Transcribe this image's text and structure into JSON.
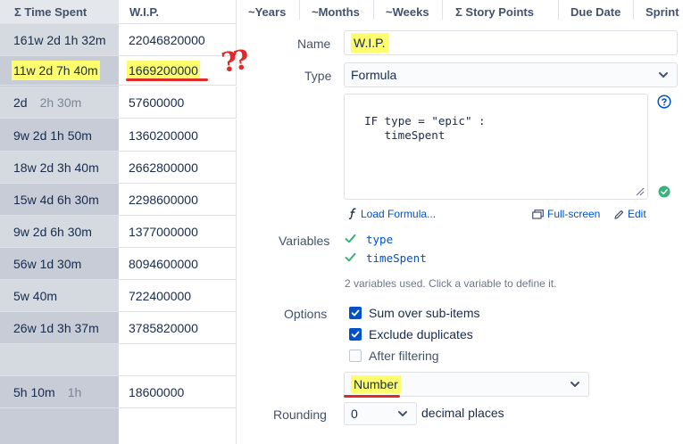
{
  "table": {
    "headers": {
      "time_spent": "Σ Time Spent",
      "wip": "W.I.P."
    },
    "rows": [
      {
        "time": "161w 2d 1h 32m",
        "extra": "",
        "wip": "22046820000"
      },
      {
        "time": "11w 2d 7h 40m",
        "extra": "",
        "wip": "1669200000"
      },
      {
        "time": "2d",
        "extra": "2h 30m",
        "wip": "57600000"
      },
      {
        "time": "9w 2d 1h 50m",
        "extra": "",
        "wip": "1360200000"
      },
      {
        "time": "18w 2d 3h 40m",
        "extra": "",
        "wip": "2662800000"
      },
      {
        "time": "15w 4d 6h 30m",
        "extra": "",
        "wip": "2298600000"
      },
      {
        "time": "9w 2d 6h 30m",
        "extra": "",
        "wip": "1377000000"
      },
      {
        "time": "56w 1d 30m",
        "extra": "",
        "wip": "8094600000"
      },
      {
        "time": "5w 40m",
        "extra": "",
        "wip": "722400000"
      },
      {
        "time": "26w 1d 3h 37m",
        "extra": "",
        "wip": "3785820000"
      },
      {
        "time": "",
        "extra": "",
        "wip": ""
      },
      {
        "time": "5h 10m",
        "extra": "1h",
        "wip": "18600000"
      }
    ],
    "annotation": "??"
  },
  "top_columns": [
    "~Years",
    "~Months",
    "~Weeks",
    "Σ Story Points",
    "Due Date",
    "Sprint"
  ],
  "panel": {
    "name_label": "Name",
    "name_value": "W.I.P.",
    "type_label": "Type",
    "type_value": "Formula",
    "formula": "IF type = \"epic\" :\n     timeSpent",
    "load_formula": "Load Formula...",
    "fullscreen": "Full-screen",
    "edit": "Edit",
    "variables_label": "Variables",
    "variables": [
      "type",
      "timeSpent"
    ],
    "variables_hint": "2 variables used. Click a variable to define it.",
    "options_label": "Options",
    "options": [
      {
        "label": "Sum over sub-items",
        "checked": true
      },
      {
        "label": "Exclude duplicates",
        "checked": true
      },
      {
        "label": "After filtering",
        "checked": false
      }
    ],
    "format_value": "Number",
    "rounding_label": "Rounding",
    "rounding_value": "0",
    "decimal_label": "decimal places"
  },
  "colors": {
    "accent": "#0052cc",
    "success": "#36b37e",
    "highlight": "#fdfd6e",
    "annotation": "#e02a2a"
  }
}
